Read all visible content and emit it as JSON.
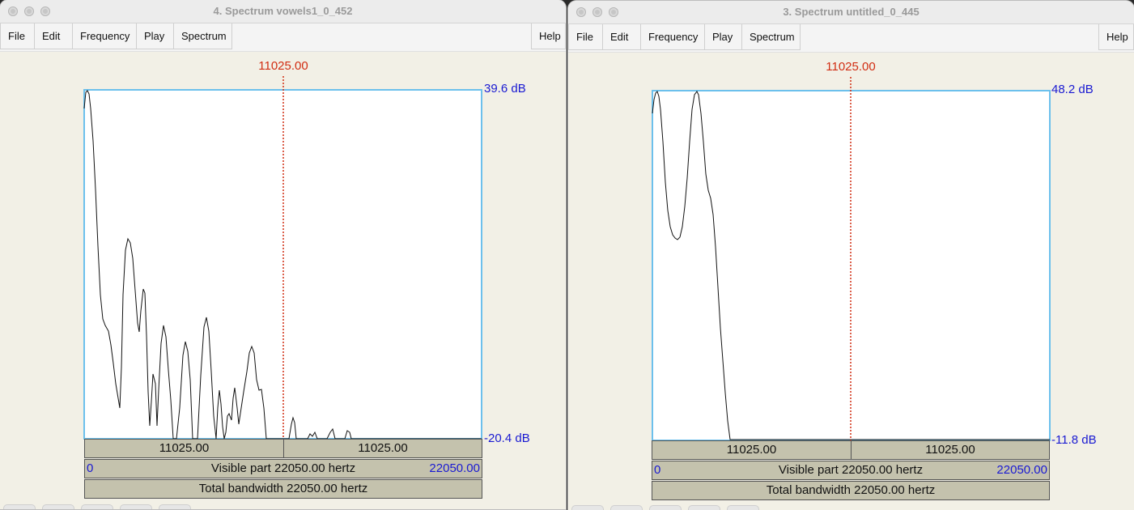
{
  "windows": [
    {
      "title": "4. Spectrum vowels1_0_452",
      "menu": [
        "File",
        "Edit",
        "Frequency",
        "Play",
        "Spectrum"
      ],
      "help": "Help",
      "cursor": "11025.00",
      "db_top": "39.6 dB",
      "db_bottom": "-20.4 dB",
      "left_half": "11025.00",
      "right_half": "11025.00",
      "visible_start": "0",
      "visible_label": "Visible part 22050.00 hertz",
      "visible_end": "22050.00",
      "total_label": "Total bandwidth 22050.00 hertz",
      "colors": {
        "frame": "#6cc0ec",
        "cursor": "#d12d12",
        "axis_blue": "#1a1ad2"
      }
    },
    {
      "title": "3. Spectrum untitled_0_445",
      "menu": [
        "File",
        "Edit",
        "Frequency",
        "Play",
        "Spectrum"
      ],
      "help": "Help",
      "cursor": "11025.00",
      "db_top": "48.2 dB",
      "db_bottom": "-11.8 dB",
      "left_half": "11025.00",
      "right_half": "11025.00",
      "visible_start": "0",
      "visible_label": "Visible part 22050.00 hertz",
      "visible_end": "22050.00",
      "total_label": "Total bandwidth 22050.00 hertz",
      "colors": {
        "frame": "#6cc0ec",
        "cursor": "#d12d12",
        "axis_blue": "#1a1ad2"
      }
    }
  ]
}
